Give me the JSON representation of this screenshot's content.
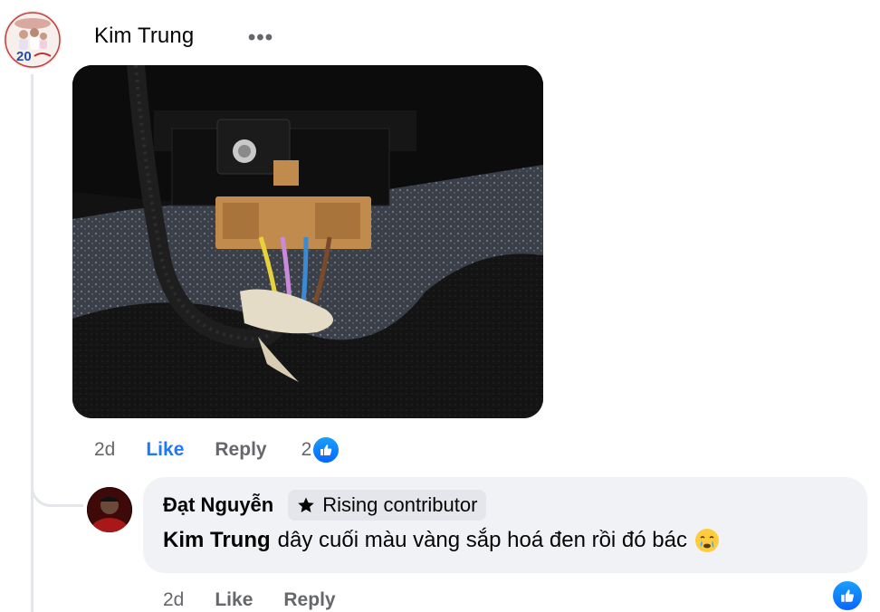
{
  "comment": {
    "author": "Kim Trung",
    "more_label": "•••",
    "actions": {
      "time": "2d",
      "like": "Like",
      "reply": "Reply",
      "reaction_count": "2"
    }
  },
  "reply": {
    "author": "Đạt Nguyễn",
    "badge": "Rising contributor",
    "mention": "Kim Trung",
    "text": "dây cuối màu vàng sắp hoá đen rồi đó bác",
    "emoji": "crying-face-icon",
    "actions": {
      "time": "2d",
      "like": "Like",
      "reply": "Reply"
    }
  },
  "colors": {
    "like_active": "#2078f4",
    "secondary_text": "#65676b",
    "bubble_bg": "#f0f2f5",
    "like_badge": "#0866ff"
  }
}
